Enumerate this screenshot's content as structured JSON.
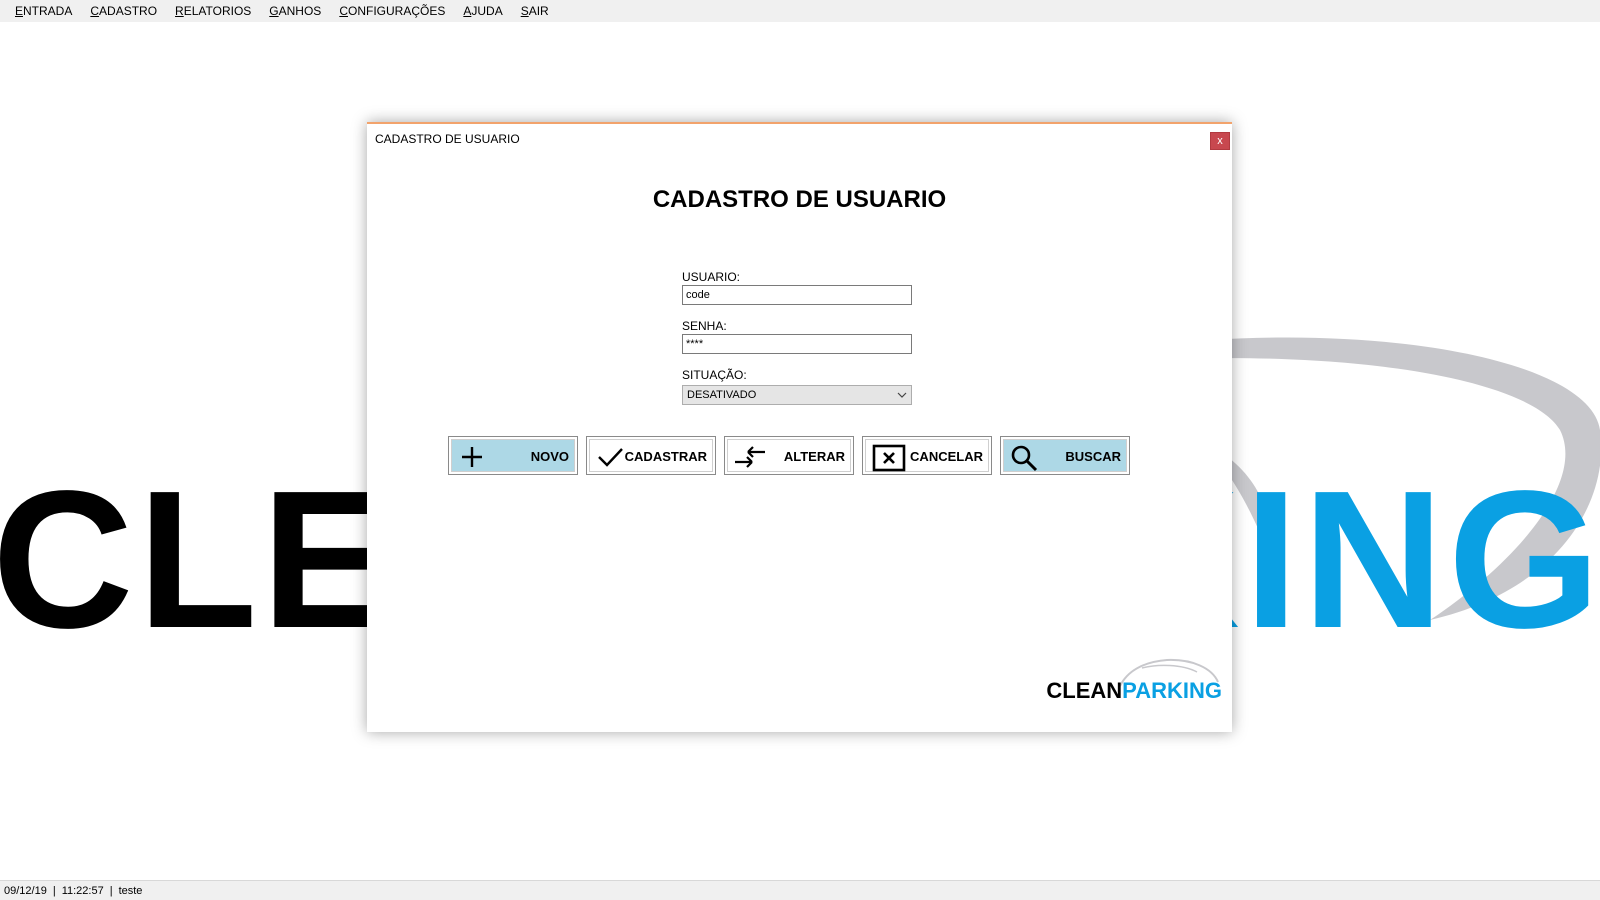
{
  "menu": {
    "items": [
      {
        "mnemonic": "E",
        "rest": "NTRADA"
      },
      {
        "mnemonic": "C",
        "rest": "ADASTRO"
      },
      {
        "mnemonic": "R",
        "rest": "ELATORIOS"
      },
      {
        "mnemonic": "G",
        "rest": "ANHOS"
      },
      {
        "mnemonic": "C",
        "rest": "ONFIGURAÇÕES"
      },
      {
        "mnemonic": "A",
        "rest": "JUDA"
      },
      {
        "mnemonic": "S",
        "rest": "AIR"
      }
    ]
  },
  "background_logo": {
    "part1": "CLEAN",
    "part2": "PARKING",
    "color_dark": "#000000",
    "color_accent": "#0aa0e3",
    "swoosh_color": "#c8c8cc"
  },
  "dialog": {
    "title": "CADASTRO DE USUARIO",
    "close_label": "x",
    "heading": "CADASTRO DE USUARIO",
    "usuario_label": "USUARIO:",
    "usuario_value": "code",
    "senha_label": "SENHA:",
    "senha_value": "****",
    "situacao_label": "SITUAÇÃO:",
    "situacao_value": "DESATIVADO",
    "buttons": {
      "novo": {
        "label": "NOVO",
        "icon": "plus-icon"
      },
      "cadastrar": {
        "label": "CADASTRAR",
        "icon": "check-icon"
      },
      "alterar": {
        "label": "ALTERAR",
        "icon": "swap-arrows-icon"
      },
      "cancelar": {
        "label": "CANCELAR",
        "icon": "box-x-icon"
      },
      "buscar": {
        "label": "BUSCAR",
        "icon": "magnifier-icon"
      }
    },
    "button_highlight_color": "#add8e6",
    "logo": {
      "part1": "CLEAN",
      "part2": "PARKING"
    }
  },
  "status": {
    "date": "09/12/19",
    "time": "11:22:57",
    "user": "teste"
  }
}
